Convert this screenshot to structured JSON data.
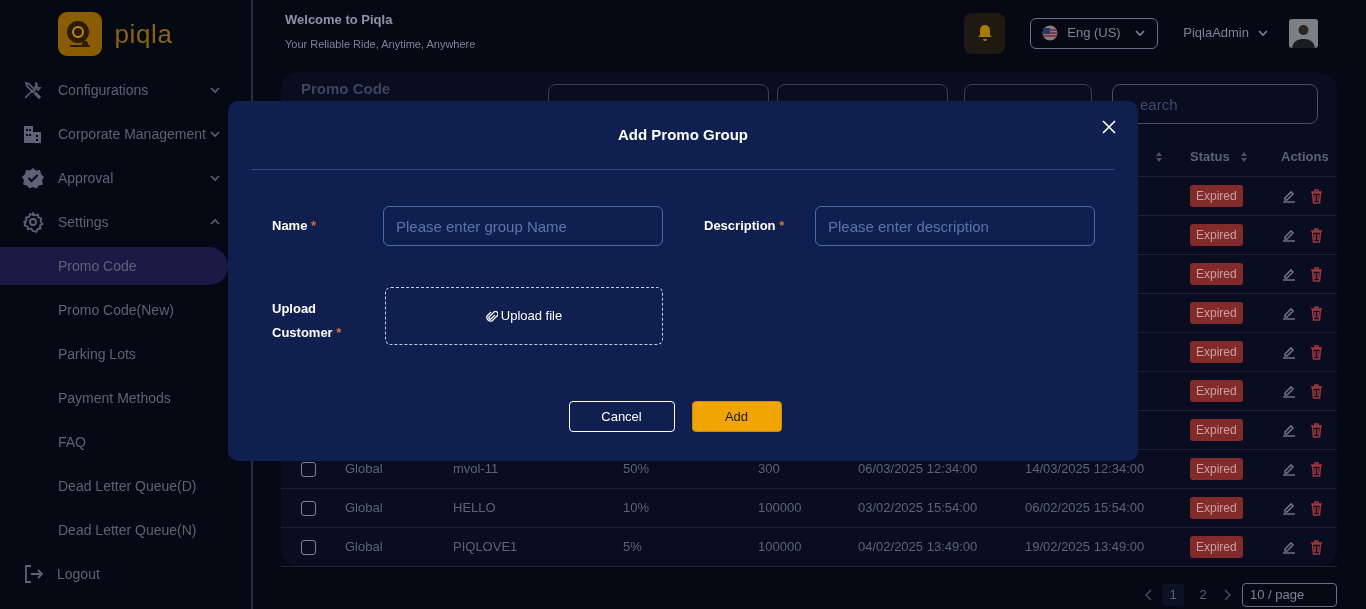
{
  "sidebar": {
    "brand": "piqla",
    "items": [
      {
        "label": "Configurations",
        "expanded": false
      },
      {
        "label": "Corporate Management",
        "expanded": false
      },
      {
        "label": "Approval",
        "expanded": false
      },
      {
        "label": "Settings",
        "expanded": true,
        "children": [
          {
            "label": "Promo Code",
            "selected": true
          },
          {
            "label": "Promo Code(New)",
            "selected": false
          },
          {
            "label": "Parking Lots",
            "selected": false
          },
          {
            "label": "Payment Methods",
            "selected": false
          },
          {
            "label": "FAQ",
            "selected": false
          },
          {
            "label": "Dead Letter Queue(D)",
            "selected": false
          },
          {
            "label": "Dead Letter Queue(N)",
            "selected": false
          }
        ]
      }
    ],
    "logout": "Logout"
  },
  "header": {
    "title": "Welcome to Piqla",
    "subtitle": "Your Reliable Ride, Anytime, Anywhere",
    "language": "Eng (US)",
    "user": "PiqlaAdmin"
  },
  "card": {
    "title": "Promo Code",
    "search_placeholder": "earch",
    "columns": [
      {
        "label": "Status"
      },
      {
        "label": "Actions"
      }
    ],
    "rows": [
      {
        "status": "Expired"
      },
      {
        "status": "Expired"
      },
      {
        "status": "Expired"
      },
      {
        "status": "Expired"
      },
      {
        "status": "Expired"
      },
      {
        "status": "Expired"
      },
      {
        "status": "Expired"
      },
      {
        "checked": false,
        "type": "Global",
        "code": "mvol-11",
        "discount": "50%",
        "usage": "300",
        "start": "06/03/2025 12:34:00",
        "end": "14/03/2025 12:34:00",
        "status": "Expired"
      },
      {
        "checked": false,
        "type": "Global",
        "code": "HELLO",
        "discount": "10%",
        "usage": "100000",
        "start": "03/02/2025 15:54:00",
        "end": "06/02/2025 15:54:00",
        "status": "Expired"
      },
      {
        "checked": false,
        "type": "Global",
        "code": "PIQLOVE1",
        "discount": "5%",
        "usage": "100000",
        "start": "04/02/2025 13:49:00",
        "end": "19/02/2025 13:49:00",
        "status": "Expired"
      }
    ],
    "pagination": {
      "pages": [
        {
          "label": "1",
          "selected": true
        },
        {
          "label": "2",
          "selected": false
        }
      ],
      "page_size": "10 / page"
    }
  },
  "modal": {
    "title": "Add Promo Group",
    "fields": [
      {
        "label": "Name",
        "required_mark": "*",
        "placeholder": "Please enter group Name"
      },
      {
        "label": "Description",
        "required_mark": "*",
        "placeholder": "Please enter description"
      }
    ],
    "upload": {
      "label": "Upload Customer",
      "required_mark": "*",
      "button": "Upload file"
    },
    "buttons": [
      {
        "label": "Cancel",
        "kind": "secondary"
      },
      {
        "label": "Add",
        "kind": "primary"
      }
    ]
  }
}
